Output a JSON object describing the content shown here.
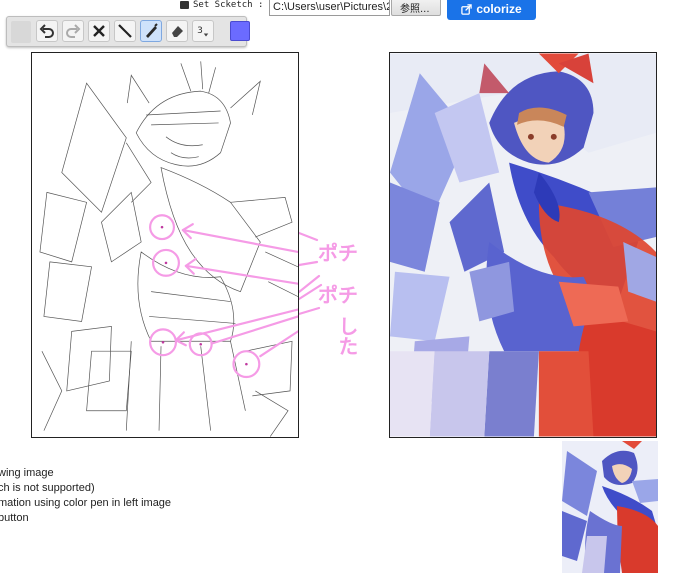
{
  "topbar": {
    "set_sketch_label": "Set Scketch :",
    "path_value": "C:\\Users\\user\\Pictures\\20",
    "browse_label": "参照...",
    "colorize_label": "colorize"
  },
  "toolbar": {
    "pen_size": "3",
    "pen_color": "#6b6bff"
  },
  "annotation": {
    "line1": "ポチ",
    "line2": "ポチ",
    "line3": "した"
  },
  "instructions": [
    "wing image",
    " ch is not supported)",
    "mation using color pen in left image",
    " button"
  ],
  "colors": {
    "accent": "#1a73e8",
    "hint_pink": "#f59be6"
  }
}
